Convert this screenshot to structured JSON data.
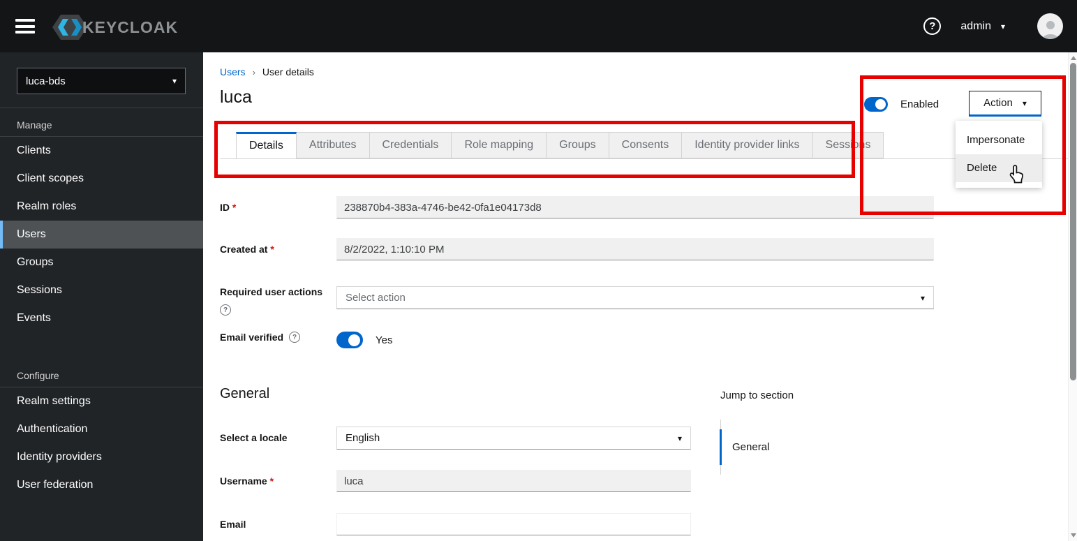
{
  "header": {
    "brand": "KEYCLOAK",
    "username": "admin",
    "help_icon": "question-circle-icon",
    "avatar_icon": "user-avatar-icon"
  },
  "sidebar": {
    "realm": "luca-bds",
    "sections": [
      {
        "title": "Manage",
        "items": [
          {
            "label": "Clients",
            "current": false
          },
          {
            "label": "Client scopes",
            "current": false
          },
          {
            "label": "Realm roles",
            "current": false
          },
          {
            "label": "Users",
            "current": true
          },
          {
            "label": "Groups",
            "current": false
          },
          {
            "label": "Sessions",
            "current": false
          },
          {
            "label": "Events",
            "current": false
          }
        ]
      },
      {
        "title": "Configure",
        "items": [
          {
            "label": "Realm settings",
            "current": false
          },
          {
            "label": "Authentication",
            "current": false
          },
          {
            "label": "Identity providers",
            "current": false
          },
          {
            "label": "User federation",
            "current": false
          }
        ]
      }
    ]
  },
  "breadcrumb": {
    "link": "Users",
    "separator": "›",
    "current": "User details"
  },
  "page": {
    "title": "luca",
    "enabled_toggle": {
      "label": "Enabled",
      "on": true
    },
    "action_menu": {
      "button": "Action",
      "items": [
        {
          "label": "Impersonate",
          "highlighted": false
        },
        {
          "label": "Delete",
          "highlighted": true
        }
      ]
    }
  },
  "tabs": [
    {
      "label": "Details",
      "active": true
    },
    {
      "label": "Attributes",
      "active": false
    },
    {
      "label": "Credentials",
      "active": false
    },
    {
      "label": "Role mapping",
      "active": false
    },
    {
      "label": "Groups",
      "active": false
    },
    {
      "label": "Consents",
      "active": false
    },
    {
      "label": "Identity provider links",
      "active": false
    },
    {
      "label": "Sessions",
      "active": false
    }
  ],
  "form": {
    "id_field": {
      "label": "ID",
      "required": true,
      "value": "238870b4-383a-4746-be42-0fa1e04173d8",
      "readonly": true
    },
    "created_field": {
      "label": "Created at",
      "required": true,
      "value": "8/2/2022, 1:10:10 PM",
      "readonly": true
    },
    "actions_field": {
      "label": "Required user actions",
      "has_help": true,
      "placeholder": "Select action"
    },
    "email_verified": {
      "label": "Email verified",
      "has_help": true,
      "on": true,
      "state_text": "Yes"
    }
  },
  "general_section": {
    "title": "General",
    "locale_field": {
      "label": "Select a locale",
      "value": "English"
    },
    "username_field": {
      "label": "Username",
      "required": true,
      "value": "luca",
      "readonly": true
    },
    "email_field": {
      "label": "Email",
      "value": ""
    }
  },
  "jump_nav": {
    "title": "Jump to section",
    "items": [
      {
        "label": "General",
        "current": true
      }
    ]
  },
  "colors": {
    "accent": "#0066cc",
    "annotation": "#e60000",
    "nav_current_indicator": "#73bcf7",
    "toggle_on": "#0066cc"
  }
}
